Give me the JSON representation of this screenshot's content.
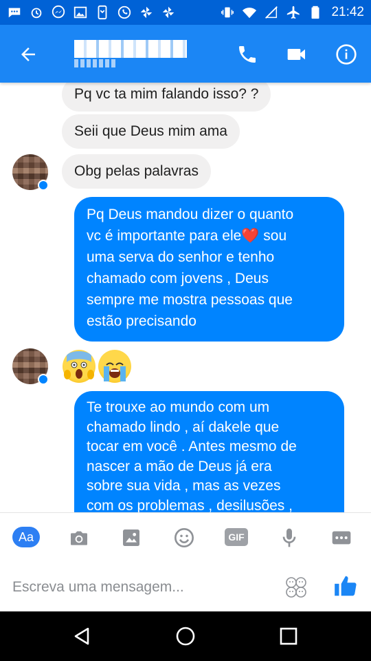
{
  "status_bar": {
    "time": "21:42",
    "icons": [
      "chat-icon",
      "alarm-icon",
      "messenger-icon",
      "image-icon",
      "phone-icon",
      "whatsapp-icon",
      "pinwheel-icon",
      "pinwheel-icon",
      "vibrate-icon",
      "wifi-icon",
      "no-sim-icon",
      "airplane-icon",
      "battery-icon"
    ]
  },
  "header": {
    "contact_name": "█████████",
    "actions": [
      "phone-icon",
      "video-icon",
      "info-icon"
    ]
  },
  "messages": [
    {
      "direction": "in",
      "text": "Pq vc ta mim falando isso? ?"
    },
    {
      "direction": "in",
      "text": "Seii que Deus mim ama"
    },
    {
      "direction": "in",
      "text": "Obg pelas palavras"
    },
    {
      "direction": "out",
      "lines": [
        "Pq Deus mandou dizer o quanto",
        "vc é importante para ele❤️ sou",
        "uma serva do senhor e tenho",
        "chamado com jovens , Deus",
        "sempre me mostra pessoas que",
        "estão precisando"
      ]
    },
    {
      "direction": "in",
      "emojis": [
        "😱",
        "😭"
      ]
    },
    {
      "direction": "out",
      "lines": [
        "Te trouxe ao mundo com um",
        "chamado lindo , aí dakele que",
        "tocar em você . Antes mesmo de",
        "nascer a mão de Deus já era",
        "sobre sua vida , mas as vezes",
        "com os problemas , desilusões ,"
      ]
    }
  ],
  "composer": {
    "aa_label": "Aa",
    "gif_label": "GIF",
    "placeholder": "Escreva uma mensagem...",
    "tools": [
      "camera-icon",
      "gallery-icon",
      "emoji-icon",
      "gif-icon",
      "microphone-icon",
      "more-icon"
    ]
  },
  "colors": {
    "status_bar": "#0062d6",
    "app_bar": "#1b86f5",
    "bubble_out": "#0084ff",
    "bubble_in": "#f1f0f0"
  }
}
